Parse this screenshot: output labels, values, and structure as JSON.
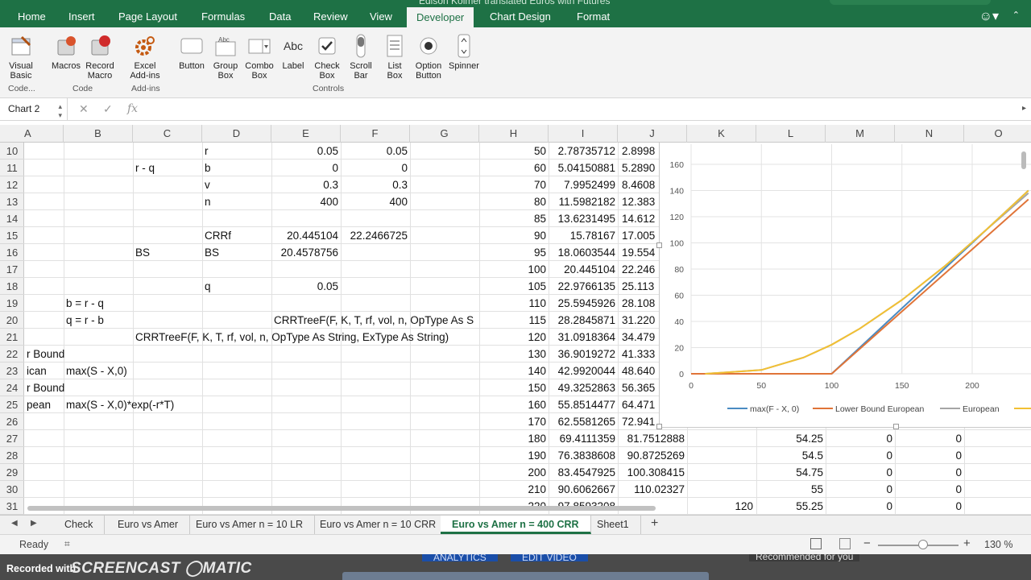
{
  "window": {
    "title_fragment": "Edison Kolmer translated Euros with Futures"
  },
  "ribbon_tabs": [
    "Home",
    "Insert",
    "Page Layout",
    "Formulas",
    "Data",
    "Review",
    "View",
    "Developer",
    "Chart Design",
    "Format"
  ],
  "active_tab": "Developer",
  "ribbon": {
    "visual_basic": "Visual\nBasic",
    "macros": "Macros",
    "record_macro": "Record\nMacro",
    "excel_addins": "Excel\nAdd-ins",
    "button": "Button",
    "group_box": "Group\nBox",
    "combo_box": "Combo\nBox",
    "label": "Label",
    "check_box": "Check\nBox",
    "scroll_bar": "Scroll\nBar",
    "list_box": "List\nBox",
    "option_button": "Option\nButton",
    "spinner": "Spinner",
    "groups": {
      "code_left": "Code...",
      "code": "Code",
      "addins": "Add-ins",
      "controls": "Controls"
    },
    "label_icon_text": "Abc",
    "groupbox_icon_text": "Abc"
  },
  "name_box": "Chart 2",
  "formula_bar": {
    "fx": "fx",
    "content": ""
  },
  "columns": [
    "A",
    "B",
    "C",
    "D",
    "E",
    "F",
    "G",
    "H",
    "I",
    "J",
    "K",
    "L",
    "M",
    "N",
    "O"
  ],
  "row_numbers": [
    "10",
    "11",
    "12",
    "13",
    "14",
    "15",
    "16",
    "17",
    "18",
    "19",
    "20",
    "21",
    "22",
    "23",
    "24",
    "25",
    "26",
    "27",
    "28",
    "29",
    "30",
    "31"
  ],
  "cells": {
    "D10": "r",
    "E10": "0.05",
    "F10": "0.05",
    "C11": "r - q",
    "D11": "b",
    "E11": "0",
    "F11": "0",
    "D12": "v",
    "E12": "0.3",
    "F12": "0.3",
    "D13": "n",
    "E13": "400",
    "F13": "400",
    "D15": "CRRf",
    "E15": "20.445104",
    "F15": "22.2466725",
    "C16": "BS",
    "D16": "BS",
    "E16": "20.4578756",
    "D18": "q",
    "E18": "0.05",
    "B19": "b = r - q",
    "B20": "q = r - b",
    "E20": "CRRTreeF(F, K, T, rf, vol, n, OpType As S",
    "C21": "CRRTreeF(F, K, T, rf, vol, n, OpType As String, ExType As String)",
    "A22": "r Bound",
    "A23": "ican",
    "B23": "max(S - X,0)",
    "A24": "r Bound",
    "A25": "pean",
    "B25": "max(S - X,0)*exp(-r*T)"
  },
  "col_h": [
    "50",
    "60",
    "70",
    "80",
    "85",
    "90",
    "95",
    "100",
    "105",
    "110",
    "115",
    "120",
    "130",
    "140",
    "150",
    "160",
    "170",
    "180",
    "190",
    "200",
    "210",
    "220"
  ],
  "col_i": [
    "2.78735712",
    "5.04150881",
    "7.9952499",
    "11.5982182",
    "13.6231495",
    "15.78167",
    "18.0603544",
    "20.445104",
    "22.9766135",
    "25.5945926",
    "28.2845871",
    "31.0918364",
    "36.9019272",
    "42.9920044",
    "49.3252863",
    "55.8514477",
    "62.5581265",
    "69.4111359",
    "76.3838608",
    "83.4547925",
    "90.6062667",
    "97.8593208"
  ],
  "col_j": [
    "2.8998",
    "5.2890",
    "8.4608",
    "12.383",
    "14.612",
    "17.005",
    "19.554",
    "22.246",
    "25.113",
    "28.108",
    "31.220",
    "34.479",
    "41.333",
    "48.640",
    "56.365",
    "64.471",
    "72.941",
    "81.7512888",
    "90.8725269",
    "100.308415",
    "110.02327",
    "120"
  ],
  "rows_27_31": {
    "L": [
      "54.25",
      "54.5",
      "54.75",
      "55",
      "55.25"
    ],
    "M": [
      "0",
      "0",
      "0",
      "0",
      "0"
    ],
    "N": [
      "0",
      "0",
      "0",
      "0",
      "0"
    ]
  },
  "chart_data": {
    "type": "line",
    "x_ticks": [
      "0",
      "50",
      "100",
      "150",
      "200"
    ],
    "y_ticks": [
      "0",
      "20",
      "40",
      "60",
      "80",
      "100",
      "120",
      "140",
      "160"
    ],
    "xlim": [
      0,
      240
    ],
    "ylim": [
      0,
      170
    ],
    "legend_position": "bottom",
    "series": [
      {
        "name": "max(F - X, 0)",
        "color": "#4a8bc2",
        "x": [
          0,
          100,
          150,
          200,
          240
        ],
        "y": [
          0,
          0,
          50,
          100,
          140
        ]
      },
      {
        "name": "Lower Bound European",
        "color": "#e07438",
        "x": [
          0,
          100,
          150,
          200,
          240
        ],
        "y": [
          0,
          0,
          47.6,
          95.1,
          133.2
        ]
      },
      {
        "name": "European",
        "color": "#a5a5a5",
        "x": [
          10,
          50,
          80,
          100,
          120,
          150,
          180,
          210,
          240
        ],
        "y": [
          0,
          2.9,
          12.4,
          22.2,
          34.5,
          56.4,
          81.8,
          110,
          138
        ]
      },
      {
        "name": "",
        "color": "#f2c033",
        "x": [
          10,
          50,
          80,
          100,
          120,
          150,
          180,
          210,
          240
        ],
        "y": [
          0,
          2.9,
          12.4,
          22.2,
          34.5,
          56.4,
          81.8,
          110,
          140
        ]
      }
    ]
  },
  "sheet_tabs": [
    "Check",
    "Euro vs Amer",
    "Euro vs Amer n = 10 LR",
    "Euro vs Amer n = 10 CRR",
    "Euro vs Amer n = 400 CRR",
    "Sheet1"
  ],
  "active_sheet": "Euro vs Amer n = 400 CRR",
  "status": {
    "ready": "Ready",
    "zoom": "130 %",
    "zoom_minus": "−",
    "zoom_plus": "+"
  },
  "overlay": {
    "recorded_with": "Recorded with",
    "brand": "SCREENCAST",
    "brand2": "MATIC",
    "analytics": "ANALYTICS",
    "edit_video": "EDIT VIDEO",
    "recommended": "Recommended for you"
  }
}
